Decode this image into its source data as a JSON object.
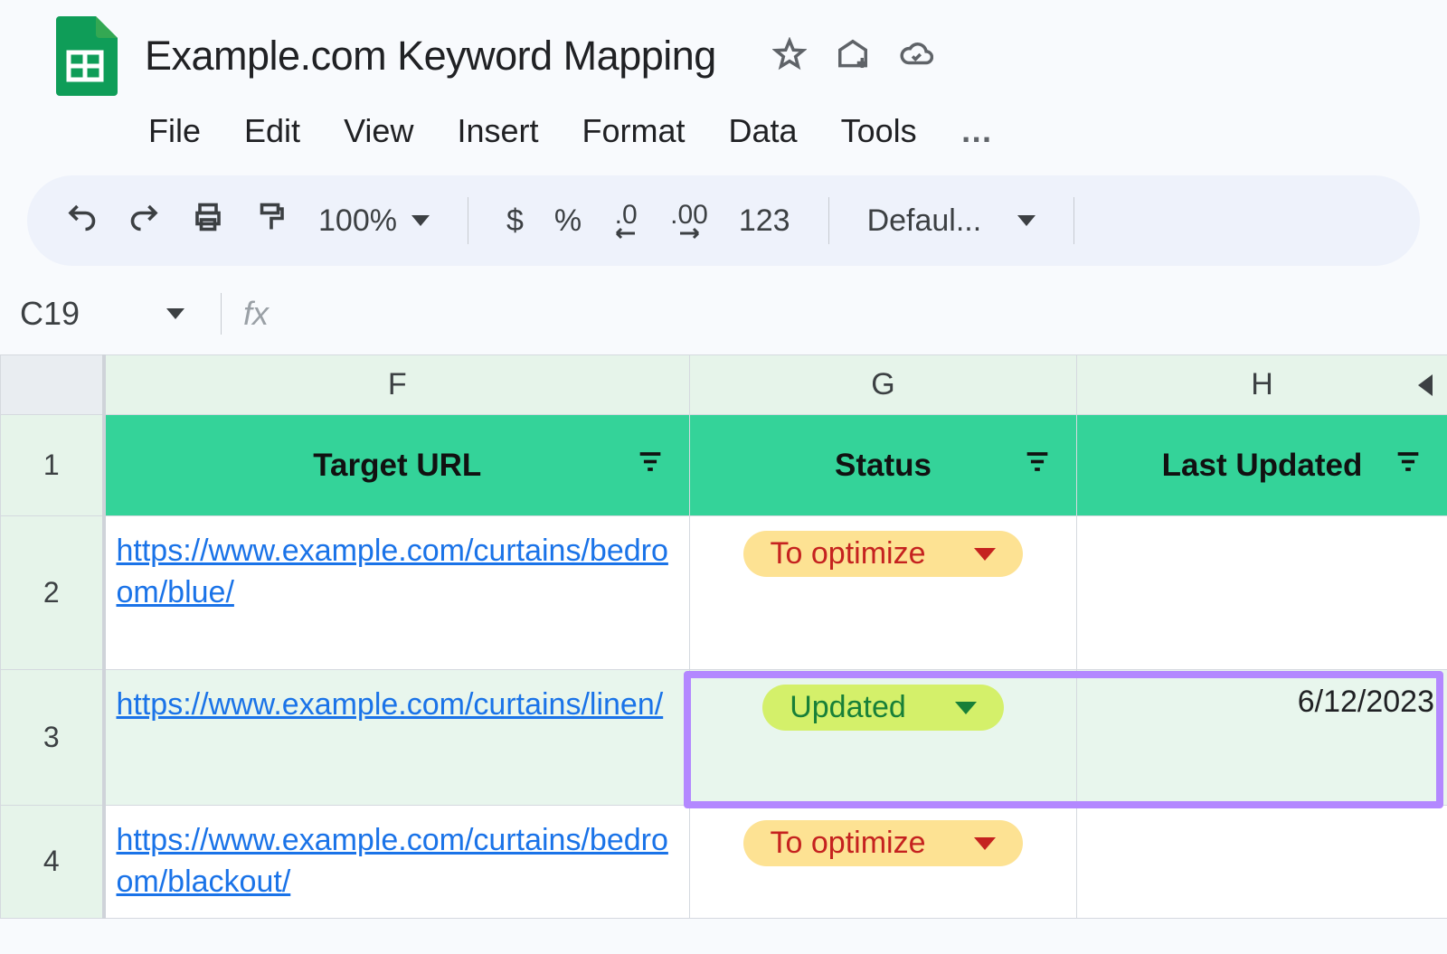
{
  "header": {
    "doc_title": "Example.com Keyword Mapping"
  },
  "menubar": {
    "items": [
      "File",
      "Edit",
      "View",
      "Insert",
      "Format",
      "Data",
      "Tools"
    ],
    "more": "…"
  },
  "toolbar": {
    "zoom": "100%",
    "currency": "$",
    "percent": "%",
    "dec_less": ".0",
    "dec_more": ".00",
    "num_fmt": "123",
    "font": "Defaul..."
  },
  "namebox": {
    "cell_ref": "C19",
    "fx": "fx"
  },
  "columns": {
    "F": "F",
    "G": "G",
    "H": "H"
  },
  "headers": {
    "row_label": "1",
    "target_url": "Target URL",
    "status": "Status",
    "last_updated": "Last Updated"
  },
  "rows": [
    {
      "num": "2",
      "url": "https://www.example.com/curtains/bedroom/blue/",
      "status": "To optimize",
      "status_kind": "to-optimize",
      "last_updated": ""
    },
    {
      "num": "3",
      "url": "https://www.example.com/curtains/linen/",
      "status": "Updated",
      "status_kind": "updated",
      "last_updated": "6/12/2023"
    },
    {
      "num": "4",
      "url": "https://www.example.com/curtains/bedroom/blackout/",
      "status": "To optimize",
      "status_kind": "to-optimize",
      "last_updated": ""
    }
  ]
}
